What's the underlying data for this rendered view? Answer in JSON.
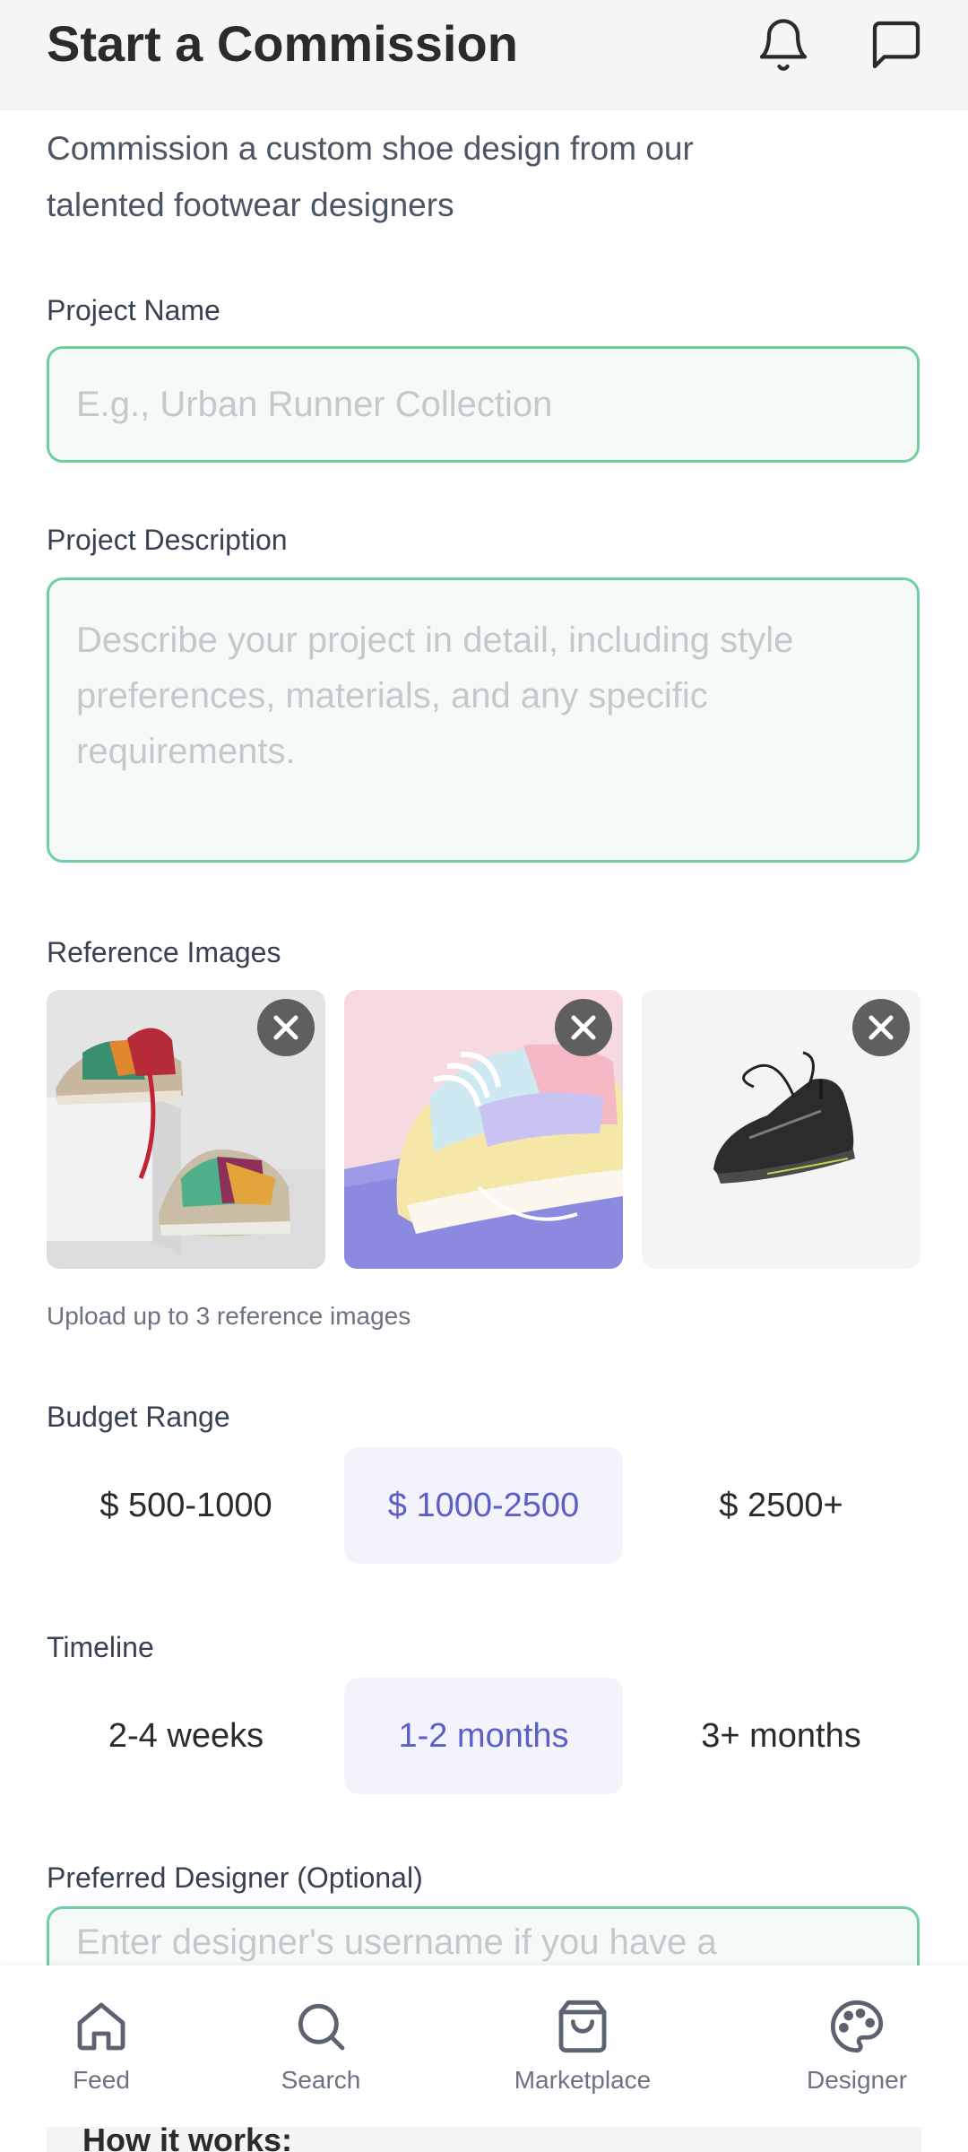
{
  "header": {
    "title": "Start a Commission",
    "icons": [
      "bell-icon",
      "chat-icon"
    ]
  },
  "intro": "Commission a custom shoe design from our talented footwear designers",
  "project_name": {
    "label": "Project Name",
    "placeholder": "E.g., Urban Runner Collection",
    "value": ""
  },
  "project_description": {
    "label": "Project Description",
    "placeholder": "Describe your project in detail, including style preferences, materials, and any specific requirements.",
    "value": ""
  },
  "reference_images": {
    "label": "Reference Images",
    "hint": "Upload up to 3 reference images",
    "images": [
      {
        "name": "colorful-sneakers-on-box-image",
        "remove_icon": "close-icon"
      },
      {
        "name": "pastel-sneaker-image",
        "remove_icon": "close-icon"
      },
      {
        "name": "black-running-shoe-image",
        "remove_icon": "close-icon"
      }
    ]
  },
  "budget": {
    "label": "Budget Range",
    "options": [
      "$ 500-1000",
      "$ 1000-2500",
      "$ 2500+"
    ],
    "selected": "$ 1000-2500"
  },
  "timeline": {
    "label": "Timeline",
    "options": [
      "2-4 weeks",
      "1-2 months",
      "3+ months"
    ],
    "selected": "1-2 months"
  },
  "preferred_designer": {
    "label": "Preferred Designer (Optional)",
    "placeholder": "Enter designer's username if you have a",
    "value": ""
  },
  "how_it_works": {
    "heading": "How it works:"
  },
  "bottom_nav": {
    "items": [
      {
        "label": "Feed",
        "icon": "home-icon"
      },
      {
        "label": "Search",
        "icon": "search-icon"
      },
      {
        "label": "Marketplace",
        "icon": "shopping-bag-icon"
      },
      {
        "label": "Designer",
        "icon": "palette-icon"
      }
    ]
  },
  "colors": {
    "accent": "#5b5fc7",
    "input_border": "#6fcf9f",
    "input_bg": "#f5faf8",
    "selected_bg": "#f3f4fb"
  }
}
